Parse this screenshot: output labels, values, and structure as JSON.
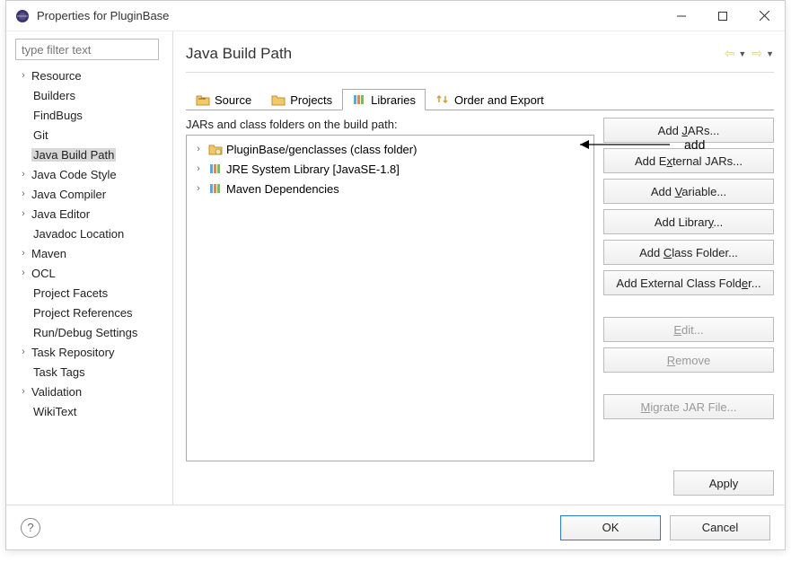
{
  "window": {
    "title": "Properties for PluginBase"
  },
  "sidebar": {
    "filter_placeholder": "type filter text",
    "items": [
      {
        "label": "Resource",
        "expandable": true
      },
      {
        "label": "Builders",
        "expandable": false
      },
      {
        "label": "FindBugs",
        "expandable": false
      },
      {
        "label": "Git",
        "expandable": false
      },
      {
        "label": "Java Build Path",
        "expandable": false,
        "selected": true
      },
      {
        "label": "Java Code Style",
        "expandable": true
      },
      {
        "label": "Java Compiler",
        "expandable": true
      },
      {
        "label": "Java Editor",
        "expandable": true
      },
      {
        "label": "Javadoc Location",
        "expandable": false
      },
      {
        "label": "Maven",
        "expandable": true
      },
      {
        "label": "OCL",
        "expandable": true
      },
      {
        "label": "Project Facets",
        "expandable": false
      },
      {
        "label": "Project References",
        "expandable": false
      },
      {
        "label": "Run/Debug Settings",
        "expandable": false
      },
      {
        "label": "Task Repository",
        "expandable": true
      },
      {
        "label": "Task Tags",
        "expandable": false
      },
      {
        "label": "Validation",
        "expandable": true
      },
      {
        "label": "WikiText",
        "expandable": false
      }
    ]
  },
  "main": {
    "title": "Java Build Path",
    "tabs": [
      {
        "label": "Source"
      },
      {
        "label": "Projects"
      },
      {
        "label": "Libraries",
        "active": true
      },
      {
        "label": "Order and Export"
      }
    ],
    "list_label": "JARs and class folders on the build path:",
    "items": [
      {
        "label": "PluginBase/genclasses (class folder)",
        "kind": "classfolder"
      },
      {
        "label": "JRE System Library [JavaSE-1.8]",
        "kind": "library"
      },
      {
        "label": "Maven Dependencies",
        "kind": "library"
      }
    ],
    "annotation": "add",
    "buttons": {
      "add_jars": "Add JARs...",
      "add_ext_jars": "Add External JARs...",
      "add_variable": "Add Variable...",
      "add_library": "Add Library...",
      "add_class_folder": "Add Class Folder...",
      "add_ext_class_folder": "Add External Class Folder...",
      "edit": "Edit...",
      "remove": "Remove",
      "migrate": "Migrate JAR File...",
      "apply": "Apply"
    }
  },
  "footer": {
    "ok": "OK",
    "cancel": "Cancel"
  }
}
